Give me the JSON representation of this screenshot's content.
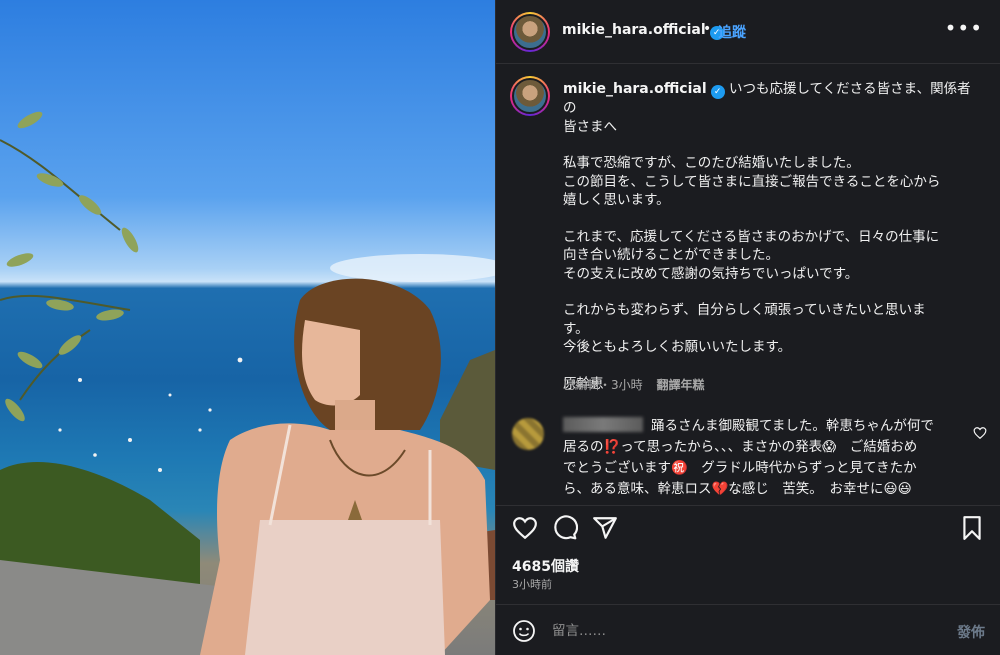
{
  "post": {
    "username": "mikie_hara.official",
    "verified_icon": "verified-badge-icon",
    "follow_label": "追蹤",
    "more_icon": "more-options-icon",
    "photo_description_icon": "post-photo"
  },
  "caption": {
    "username": "mikie_hara.official",
    "lines": [
      "いつも応援してくださる皆さま、関係者の",
      "皆さまへ",
      "",
      "私事で恐縮ですが、このたび結婚いたしました。",
      "この節目を、こうして皆さまに直接ご報告できることを心から",
      "嬉しく思います。",
      "",
      "これまで、応援してくださる皆さまのおかげで、日々の仕事に",
      "向き合い続けることができました。",
      "その支えに改めて感謝の気持ちでいっぱいです。",
      "",
      "これからも変わらず、自分らしく頑張っていきたいと思いま",
      "す。",
      "今後ともよろしくお願いいたします。",
      "",
      "原幹恵"
    ],
    "meta_edited": "已編輯・3小時",
    "translate_label": "翻譯年糕"
  },
  "comment": {
    "text_line1": "踊るさんま御殿観てました。幹恵ちゃんが何で",
    "text_line2": "居るの⁉️って思ったから、、、まさかの発表😱　ご結婚おめ",
    "text_line3": "でとうございます㊗️　グラドル時代からずっと見てきたか",
    "text_line4": "ら、ある意味、幹恵ロス💔な感じ　苦笑。　お幸せに😃😃"
  },
  "engagement": {
    "likes": "4685個讚",
    "time": "3小時前"
  },
  "composer": {
    "placeholder": "留言……",
    "post_label": "發佈"
  },
  "colors": {
    "panel_bg": "#1b1c20",
    "follow_blue": "#4aa3ff",
    "verified_blue": "#1d9bf0",
    "muted_text": "#a8a8a8"
  }
}
